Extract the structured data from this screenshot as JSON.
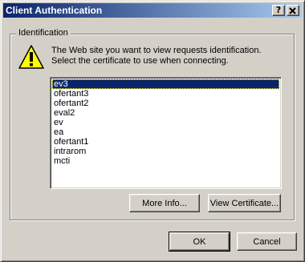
{
  "window": {
    "title": "Client Authentication",
    "help_button": "?",
    "close_button": "✕"
  },
  "group": {
    "label": "Identification"
  },
  "message": {
    "line1": "The Web site you want to view requests identification.",
    "line2": "Select the certificate to use when connecting."
  },
  "certificates": {
    "selected": "ev3",
    "items": [
      "ev3",
      "ofertant3",
      "ofertant2",
      "eval2",
      "ev",
      "ea",
      "ofertant1",
      "intrarom",
      "mcti"
    ]
  },
  "buttons": {
    "more_info": "More Info...",
    "view_certificate": "View Certificate...",
    "ok": "OK",
    "cancel": "Cancel"
  },
  "icons": {
    "warning": "warning-icon",
    "warning_color": "#ffff00"
  }
}
